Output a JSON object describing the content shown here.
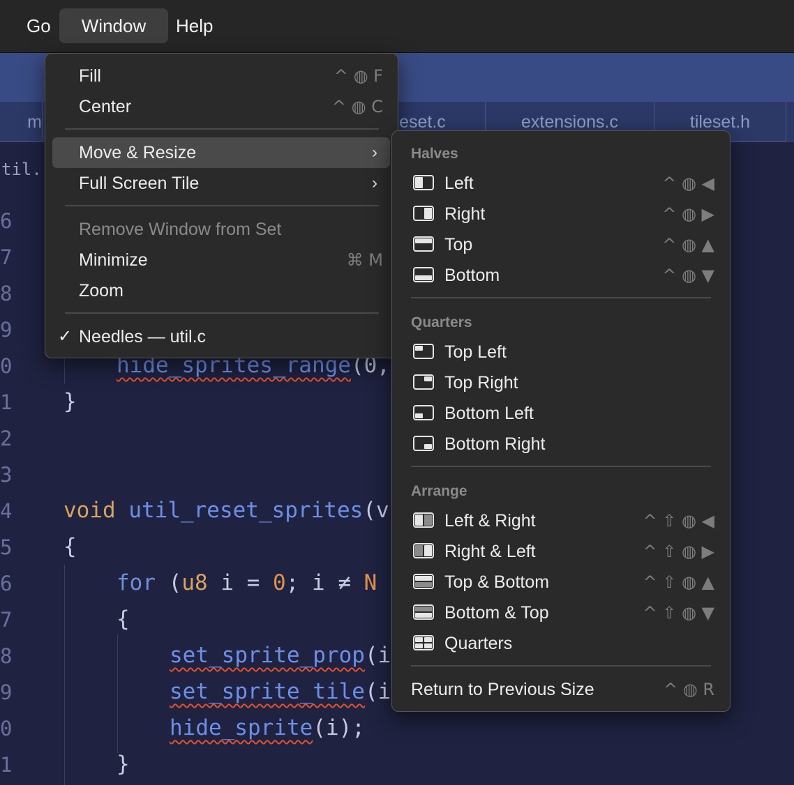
{
  "menubar": {
    "items": [
      "Go",
      "Window",
      "Help"
    ]
  },
  "editor": {
    "tabs": [
      "m",
      "ileset.c",
      "extensions.c",
      "tileset.h"
    ],
    "breadcrumb": "til.",
    "line_numbers": [
      "6",
      "7",
      "8",
      "9",
      "0",
      "1",
      "2",
      "3",
      "4",
      "5",
      "6",
      "7",
      "8",
      "9",
      "0",
      "1"
    ],
    "code": {
      "hide_sprites_range": "hide_sprites_range",
      "hide_args": "(0,",
      "close_brace": "}",
      "void": "void",
      "util_reset_sprites": "util_reset_sprites",
      "reset_tail": "(v",
      "open_brace": "{",
      "for": "for",
      "for_open": "(",
      "u8": "u8",
      "for_rest": " i = ",
      "zero": "0",
      "for_cond": "; i ≠ ",
      "for_n": "N",
      "inner_open": "{",
      "set_sprite_prop": "set_sprite_prop",
      "prop_tail": "(i",
      "set_sprite_tile": "set_sprite_tile",
      "tile_tail": "(i",
      "hide_sprite": "hide_sprite",
      "hide_tail": "(i);",
      "inner_close": "}"
    }
  },
  "window_menu": {
    "fill": {
      "label": "Fill",
      "shortcut": "^ ◍ F"
    },
    "center": {
      "label": "Center",
      "shortcut": "^ ◍ C"
    },
    "move_resize": {
      "label": "Move & Resize",
      "chevron": "›"
    },
    "full_screen_tile": {
      "label": "Full Screen Tile",
      "chevron": "›"
    },
    "remove": {
      "label": "Remove Window from Set"
    },
    "minimize": {
      "label": "Minimize",
      "shortcut": "⌘ M"
    },
    "zoom": {
      "label": "Zoom"
    },
    "window_entry": {
      "check": "✓",
      "label": "Needles — util.c"
    }
  },
  "submenu": {
    "halves_header": "Halves",
    "halves": [
      {
        "label": "Left",
        "shortcut": "^ ◍ ◀",
        "icon": "tile-left-icon"
      },
      {
        "label": "Right",
        "shortcut": "^ ◍ ▶",
        "icon": "tile-right-icon"
      },
      {
        "label": "Top",
        "shortcut": "^ ◍ ▲",
        "icon": "tile-top-icon"
      },
      {
        "label": "Bottom",
        "shortcut": "^ ◍ ▼",
        "icon": "tile-bottom-icon"
      }
    ],
    "quarters_header": "Quarters",
    "quarters": [
      {
        "label": "Top Left",
        "icon": "tile-top-left-icon"
      },
      {
        "label": "Top Right",
        "icon": "tile-top-right-icon"
      },
      {
        "label": "Bottom Left",
        "icon": "tile-bottom-left-icon"
      },
      {
        "label": "Bottom Right",
        "icon": "tile-bottom-right-icon"
      }
    ],
    "arrange_header": "Arrange",
    "arrange": [
      {
        "label": "Left & Right",
        "shortcut": "^ ⇧ ◍ ◀",
        "icon": "arrange-left-right-icon"
      },
      {
        "label": "Right & Left",
        "shortcut": "^ ⇧ ◍ ▶",
        "icon": "arrange-right-left-icon"
      },
      {
        "label": "Top & Bottom",
        "shortcut": "^ ⇧ ◍ ▲",
        "icon": "arrange-top-bottom-icon"
      },
      {
        "label": "Bottom & Top",
        "shortcut": "^ ⇧ ◍ ▼",
        "icon": "arrange-bottom-top-icon"
      },
      {
        "label": "Quarters",
        "icon": "arrange-quarters-icon"
      }
    ],
    "return": {
      "label": "Return to Previous Size",
      "shortcut": "^ ◍ R"
    }
  }
}
